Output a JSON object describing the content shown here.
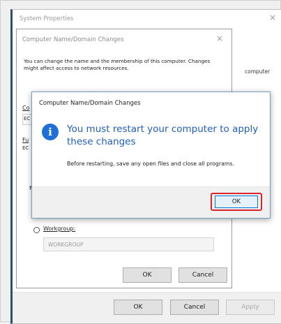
{
  "system_properties": {
    "title": "System Properties",
    "close_glyph": "×",
    "side_text": "computer",
    "buttons": {
      "ok": "OK",
      "cancel": "Cancel",
      "apply": "Apply"
    }
  },
  "name_dialog": {
    "title": "Computer Name/Domain Changes",
    "close_glyph": "×",
    "description": "You can change the name and the membership of this computer. Changes might affect access to network resources.",
    "computer_name_label_fragment": "Co",
    "full_name_label_fragment": "Fu",
    "field_fragment_1": "EC",
    "field_fragment_2": "EC",
    "member_of_fragment": "M",
    "workgroup_label": "Workgroup:",
    "workgroup_value": "WORKGROUP",
    "buttons": {
      "ok": "OK",
      "cancel": "Cancel"
    }
  },
  "alert": {
    "title": "Computer Name/Domain Changes",
    "icon": "info-icon",
    "icon_glyph": "i",
    "message": "You must restart your computer to apply these changes",
    "detail": "Before restarting, save any open files and close all programs.",
    "ok_label": "OK",
    "highlight_color": "#d8262a"
  }
}
